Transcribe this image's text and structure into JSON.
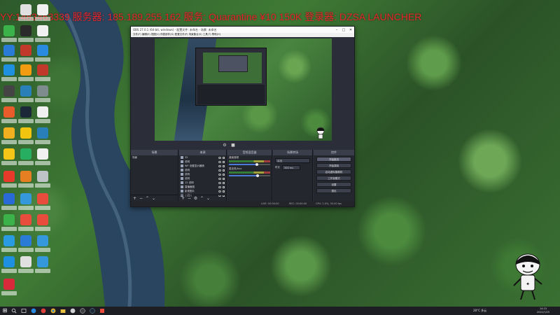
{
  "banner": {
    "text": "YY:1483463339 服务器: 185.189.255.162 服务: Quarantine ¥10 150K 登录器: DZSA LAUNCHER"
  },
  "obs": {
    "title": "OBS 27.0.1 (64-bit, windows) - 配置文件: 未命名 - 场景: 未命名",
    "menu": "文件(F)  编辑(E)  视图(V)  停靠部件(D)  配置文件(P)  场景集合(S)  工具(T)  帮助(H)",
    "scenes_header": "场景",
    "scenes": [
      "场景"
    ],
    "sources_header": "来源",
    "sources": [
      "32",
      "说明",
      "WF 设置显示器捕",
      "说明",
      "说明",
      "说明",
      "12 说明",
      "直播截图",
      "影视图片",
      "小图片"
    ],
    "mixer_header": "音频混音器",
    "mixer": [
      {
        "name": "桌面音频",
        "level": 0.68
      },
      {
        "name": "麦克风/Aux",
        "level": 0.7
      }
    ],
    "transitions_header": "场景转场",
    "transition_type": "淡出",
    "duration_label": "时长",
    "duration_value": "300 ms",
    "controls_header": "控件",
    "controls": [
      "开始推流",
      "开始录制",
      "启动虚拟摄像机",
      "工作室模式",
      "设置",
      "退出"
    ],
    "status": {
      "live": "LIVE: 00:00:00",
      "rec": "REC: 00:00:00",
      "cpu": "CPU: 2.0%, 30.00 fps"
    }
  },
  "taskbar": {
    "weather": "28°C 多云",
    "time": "14:15",
    "date": "2021/7/25"
  },
  "colors": {
    "banner": "#e8242a",
    "obs_bg": "#2b2e38",
    "selected": "#3b5f9e",
    "taskbar": "#1c1e24"
  },
  "icons": [
    "windows-start-icon",
    "search-icon",
    "task-view-icon",
    "edge-icon",
    "chrome-icon",
    "folder-icon",
    "steam-icon",
    "obs-icon",
    "recycle-bin-icon"
  ]
}
